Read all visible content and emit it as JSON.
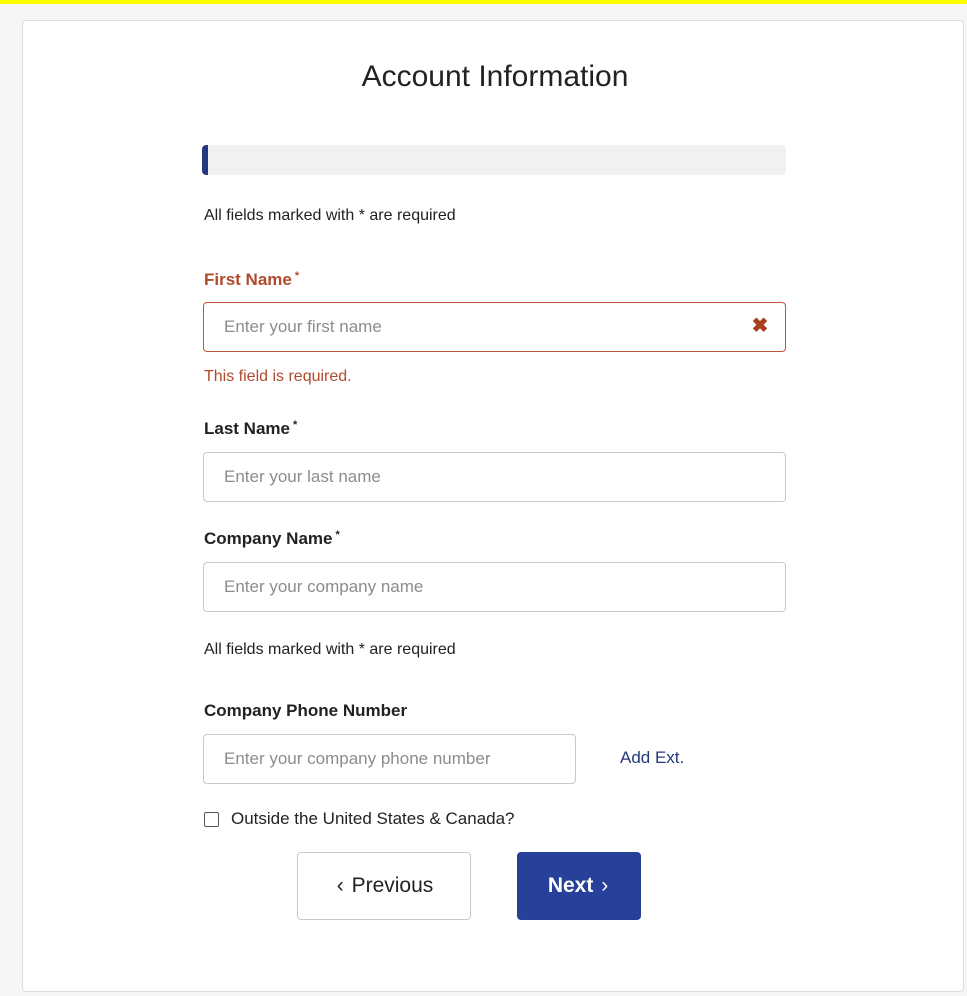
{
  "colors": {
    "accent": "#27409a",
    "progress_fill": "#23397f",
    "error": "#b14a2d",
    "top_strip": "#ffff00"
  },
  "form": {
    "title": "Account Information",
    "progress_fraction": 0.01,
    "required_note": "All fields marked with * are required",
    "first_name": {
      "label": "First Name",
      "required_mark": "*",
      "placeholder": "Enter your first name",
      "value": "",
      "error_icon": "close-x-icon",
      "error_message": "This field is required."
    },
    "last_name": {
      "label": "Last Name",
      "required_mark": "*",
      "placeholder": "Enter your last name",
      "value": ""
    },
    "company_name": {
      "label": "Company Name",
      "required_mark": "*",
      "placeholder": "Enter your company name",
      "value": ""
    },
    "required_note_2": "All fields marked with * are required",
    "company_phone": {
      "label": "Company Phone Number",
      "placeholder": "Enter your company phone number",
      "value": "",
      "add_ext_label": "Add Ext."
    },
    "outside_us_canada": {
      "label": "Outside the United States & Canada?",
      "checked": false
    },
    "buttons": {
      "previous_chevron": "‹",
      "previous_label": "Previous",
      "next_label": "Next",
      "next_chevron": "›"
    }
  }
}
